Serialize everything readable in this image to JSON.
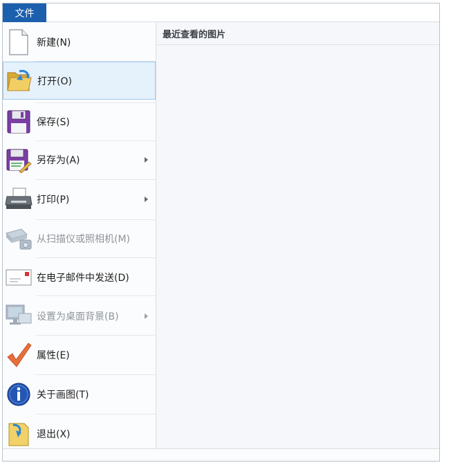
{
  "tab": {
    "file_label": "文件"
  },
  "menu": {
    "items": [
      {
        "label": "新建(N)",
        "icon": "new-document-icon"
      },
      {
        "label": "打开(O)",
        "icon": "open-folder-icon"
      },
      {
        "label": "保存(S)",
        "icon": "floppy-disk-icon"
      },
      {
        "label": "另存为(A)",
        "icon": "save-as-icon"
      },
      {
        "label": "打印(P)",
        "icon": "printer-icon"
      },
      {
        "label": "从扫描仪或照相机(M)",
        "icon": "scanner-camera-icon"
      },
      {
        "label": "在电子邮件中发送(D)",
        "icon": "email-icon"
      },
      {
        "label": "设置为桌面背景(B)",
        "icon": "desktop-background-icon"
      },
      {
        "label": "属性(E)",
        "icon": "checkmark-icon"
      },
      {
        "label": "关于画图(T)",
        "icon": "info-icon"
      },
      {
        "label": "退出(X)",
        "icon": "exit-icon"
      }
    ]
  },
  "recent": {
    "title": "最近查看的图片"
  },
  "colors": {
    "accent": "#1c5fad",
    "hover_bg": "#e5f1fb",
    "hover_border": "#9ec8ee",
    "disabled_text": "#8f949a"
  }
}
